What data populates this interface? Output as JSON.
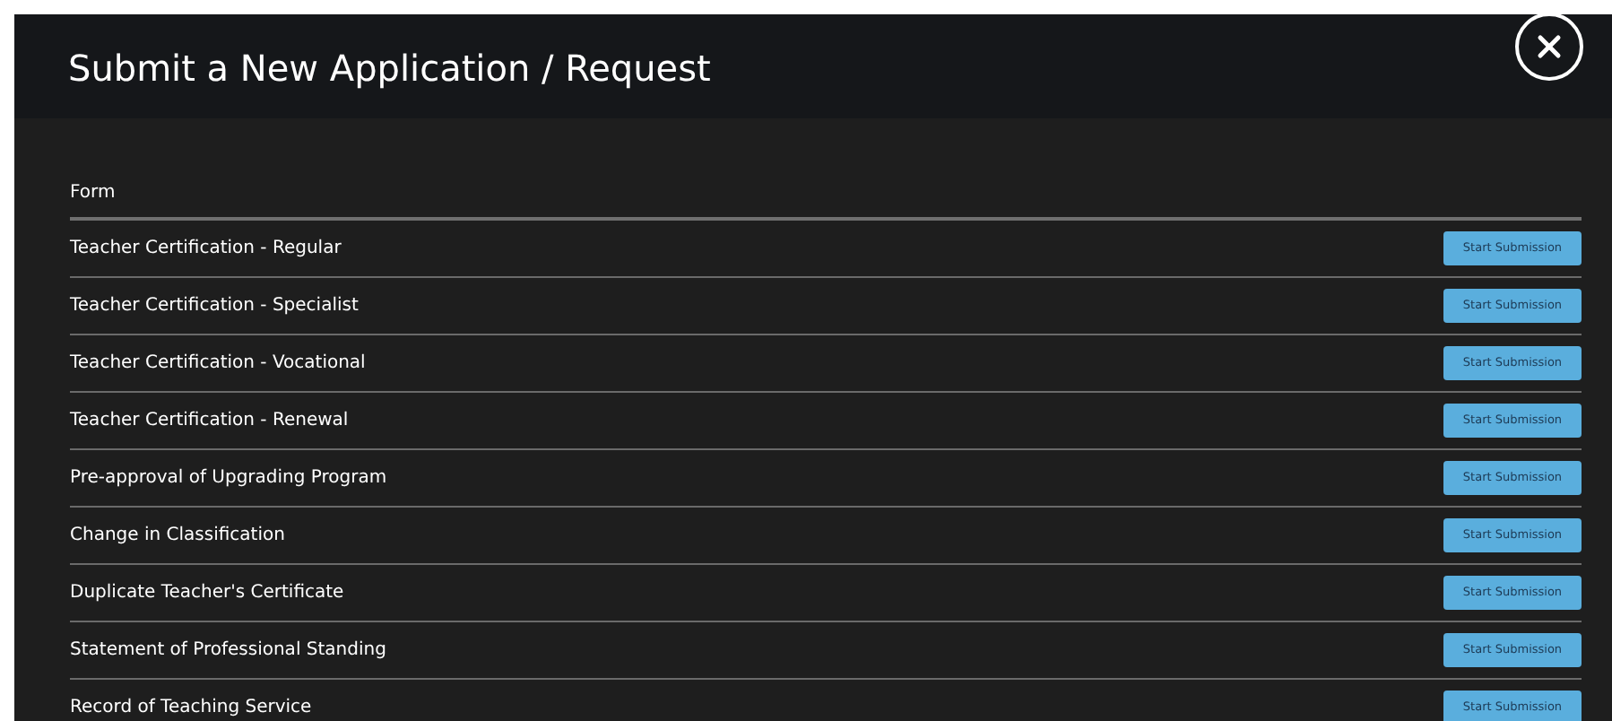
{
  "dialog": {
    "title": "Submit a New Application / Request"
  },
  "table": {
    "columns": [
      "Form"
    ],
    "rows": [
      {
        "form": "Teacher Certification - Regular",
        "action": "Start Submission"
      },
      {
        "form": "Teacher Certification - Specialist",
        "action": "Start Submission"
      },
      {
        "form": "Teacher Certification - Vocational",
        "action": "Start Submission"
      },
      {
        "form": "Teacher Certification - Renewal",
        "action": "Start Submission"
      },
      {
        "form": "Pre-approval of Upgrading Program",
        "action": "Start Submission"
      },
      {
        "form": "Change in Classification",
        "action": "Start Submission"
      },
      {
        "form": "Duplicate Teacher's Certificate",
        "action": "Start Submission"
      },
      {
        "form": "Statement of Professional Standing",
        "action": "Start Submission"
      },
      {
        "form": "Record of Teaching Service",
        "action": "Start Submission"
      }
    ]
  }
}
